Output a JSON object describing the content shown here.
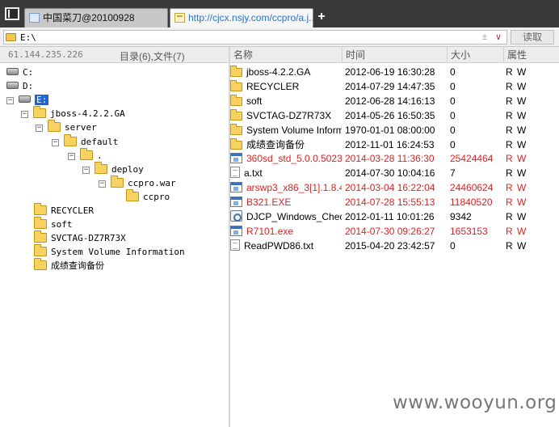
{
  "tabs": [
    {
      "label": "中国菜刀@20100928",
      "active": false
    },
    {
      "label": "http://cjcx.nsjy.com/ccpro/a.j...",
      "active": true
    }
  ],
  "new_tab_label": "+",
  "address": {
    "path": "E:\\",
    "plusminus": "±",
    "chevron": "∨",
    "read_button": "读取"
  },
  "left_header": {
    "ip": "61.144.235.226",
    "summary": "目录(6),文件(7)"
  },
  "tree": [
    {
      "label": "C:",
      "type": "drive",
      "expand": "",
      "selected": false
    },
    {
      "label": "D:",
      "type": "drive",
      "expand": "",
      "selected": false
    },
    {
      "label": "E:",
      "type": "drive",
      "expand": "−",
      "selected": true
    },
    {
      "label": "jboss-4.2.2.GA",
      "type": "folder",
      "expand": "−",
      "selected": false
    },
    {
      "label": "server",
      "type": "folder",
      "expand": "−",
      "selected": false
    },
    {
      "label": "default",
      "type": "folder",
      "expand": "−",
      "selected": false
    },
    {
      "label": ".",
      "type": "folder",
      "expand": "−",
      "selected": false
    },
    {
      "label": "deploy",
      "type": "folder",
      "expand": "−",
      "selected": false
    },
    {
      "label": "ccpro.war",
      "type": "folder",
      "expand": "−",
      "selected": false
    },
    {
      "label": "ccpro",
      "type": "folder",
      "expand": "",
      "selected": false
    },
    {
      "label": "RECYCLER",
      "type": "folder",
      "expand": "",
      "selected": false
    },
    {
      "label": "soft",
      "type": "folder",
      "expand": "",
      "selected": false
    },
    {
      "label": "SVCTAG-DZ7R73X",
      "type": "folder",
      "expand": "",
      "selected": false
    },
    {
      "label": "System Volume Information",
      "type": "folder",
      "expand": "",
      "selected": false
    },
    {
      "label": "成绩查询备份",
      "type": "folder",
      "expand": "",
      "selected": false
    }
  ],
  "columns": {
    "name": "名称",
    "time": "时间",
    "size": "大小",
    "attr": "属性"
  },
  "files": [
    {
      "name": "jboss-4.2.2.GA",
      "time": "2012-06-19 16:30:28",
      "size": "0",
      "attr": "R W",
      "icon": "folder",
      "red": false
    },
    {
      "name": "RECYCLER",
      "time": "2014-07-29 14:47:35",
      "size": "0",
      "attr": "R W",
      "icon": "folder",
      "red": false
    },
    {
      "name": "soft",
      "time": "2012-06-28 14:16:13",
      "size": "0",
      "attr": "R W",
      "icon": "folder",
      "red": false
    },
    {
      "name": "SVCTAG-DZ7R73X",
      "time": "2014-05-26 16:50:35",
      "size": "0",
      "attr": "R W",
      "icon": "folder",
      "red": false
    },
    {
      "name": "System Volume Inform...",
      "time": "1970-01-01 08:00:00",
      "size": "0",
      "attr": "R W",
      "icon": "folder",
      "red": false
    },
    {
      "name": "成绩查询备份",
      "time": "2012-11-01 16:24:53",
      "size": "0",
      "attr": "R W",
      "icon": "folder",
      "red": false
    },
    {
      "name": "360sd_std_5.0.0.5023...",
      "time": "2014-03-28 11:36:30",
      "size": "25424464",
      "attr": "R W",
      "icon": "exe",
      "red": true
    },
    {
      "name": "a.txt",
      "time": "2014-07-30 10:04:16",
      "size": "7",
      "attr": "R W",
      "icon": "txt",
      "red": false
    },
    {
      "name": "arswp3_x86_3[1].1.8.4...",
      "time": "2014-03-04 16:22:04",
      "size": "24460624",
      "attr": "R W",
      "icon": "exe",
      "red": true
    },
    {
      "name": "B321.EXE",
      "time": "2014-07-28 15:55:13",
      "size": "11840520",
      "attr": "R W",
      "icon": "exe",
      "red": true
    },
    {
      "name": "DJCP_Windows_Chec...",
      "time": "2012-01-11 10:01:26",
      "size": "9342",
      "attr": "R W",
      "icon": "setup",
      "red": false
    },
    {
      "name": "R7101.exe",
      "time": "2014-07-30 09:26:27",
      "size": "1653153",
      "attr": "R W",
      "icon": "exe",
      "red": true
    },
    {
      "name": "ReadPWD86.txt",
      "time": "2015-04-20 23:42:57",
      "size": "0",
      "attr": "R W",
      "icon": "txt",
      "red": false
    }
  ],
  "watermark": "www.wooyun.org"
}
